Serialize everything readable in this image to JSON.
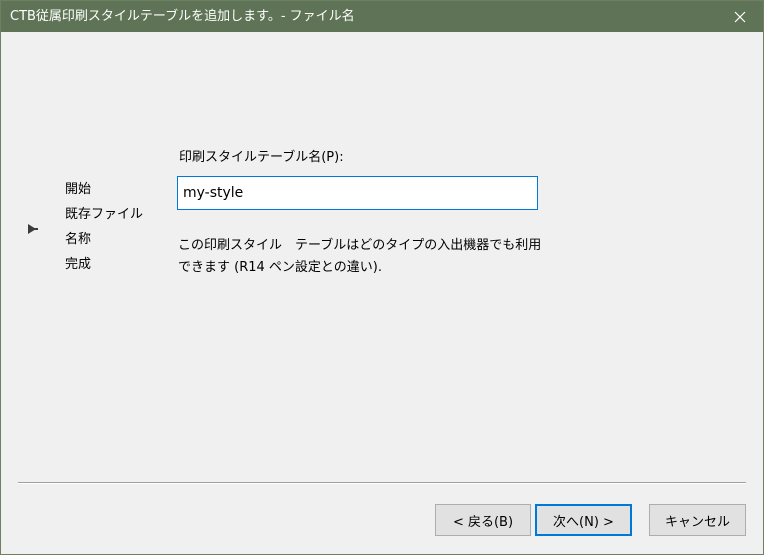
{
  "window": {
    "title": "CTB従属印刷スタイルテーブルを追加します。- ファイル名"
  },
  "steps": [
    {
      "label": "開始"
    },
    {
      "label": "既存ファイル"
    },
    {
      "label": "名称"
    },
    {
      "label": "完成"
    }
  ],
  "current_step_index": 2,
  "form": {
    "label": "印刷スタイルテーブル名(P):",
    "value": "my-style",
    "description": "この印刷スタイル　テーブルはどのタイプの入出機器でも利用できます (R14 ペン設定との違い)."
  },
  "buttons": {
    "back": "< 戻る(B)",
    "next": "次へ(N) >",
    "cancel": "キャンセル"
  },
  "colors": {
    "titlebar": "#5f7456",
    "focus_border": "#0078d7"
  }
}
